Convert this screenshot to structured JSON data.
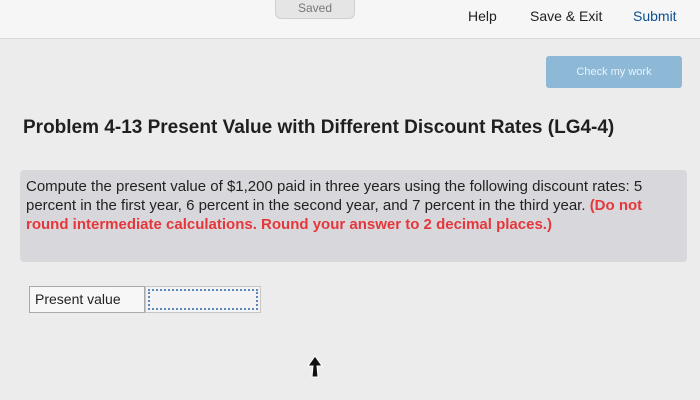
{
  "header": {
    "saved_label": "Saved",
    "help_label": "Help",
    "save_exit_label": "Save & Exit",
    "submit_label": "Submit"
  },
  "toolbar": {
    "check_my_work_label": "Check my work"
  },
  "problem": {
    "title": "Problem 4-13 Present Value with Different Discount Rates (LG4-4)",
    "question_text": "Compute the present value of $1,200 paid in three years using the following discount rates: 5 percent in the first year, 6 percent in the second year, and 7 percent in the third year.",
    "instruction_text": "(Do not round intermediate calculations. Round your answer to 2 decimal places.)"
  },
  "answer": {
    "label": "Present value",
    "value": ""
  },
  "colors": {
    "accent_link": "#0b4f91",
    "instruction_red": "#e5373b",
    "check_button_bg": "#8db9d6"
  },
  "icons": {
    "cursor": "mouse-pointer-icon"
  }
}
